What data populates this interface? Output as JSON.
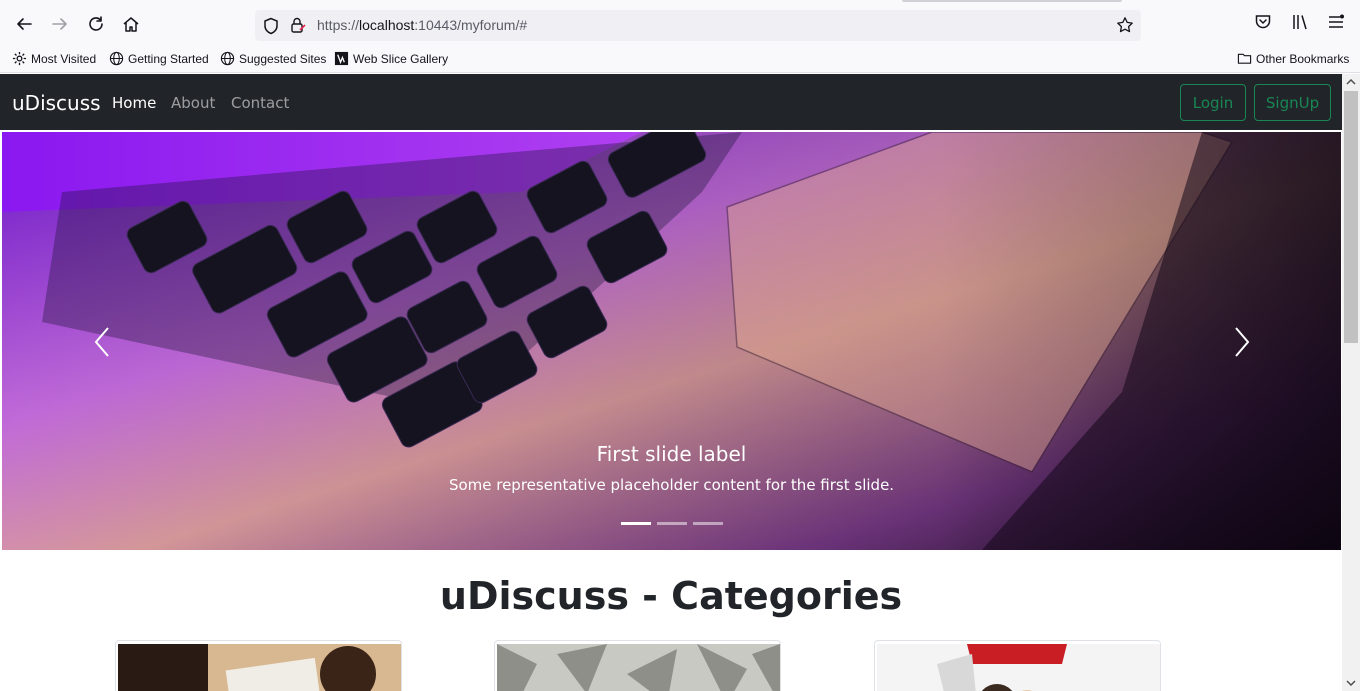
{
  "browser": {
    "url_prefix": "https://",
    "url_host": "localhost",
    "url_rest": ":10443/myforum/#",
    "bookmarks": [
      "Most Visited",
      "Getting Started",
      "Suggested Sites",
      "Web Slice Gallery"
    ],
    "other_bookmarks": "Other Bookmarks"
  },
  "navbar": {
    "brand": "uDiscuss",
    "links": [
      "Home",
      "About",
      "Contact"
    ],
    "active_link": "Home",
    "login_label": "Login",
    "signup_label": "SignUp"
  },
  "carousel": {
    "caption_title": "First slide label",
    "caption_text": "Some representative placeholder content for the first slide.",
    "slide_count": 3,
    "active_slide": 1
  },
  "categories": {
    "title": "uDiscuss - Categories"
  },
  "colors": {
    "navbar_bg": "#212529",
    "success": "#198754",
    "accent_purple": "#8a2be2"
  }
}
